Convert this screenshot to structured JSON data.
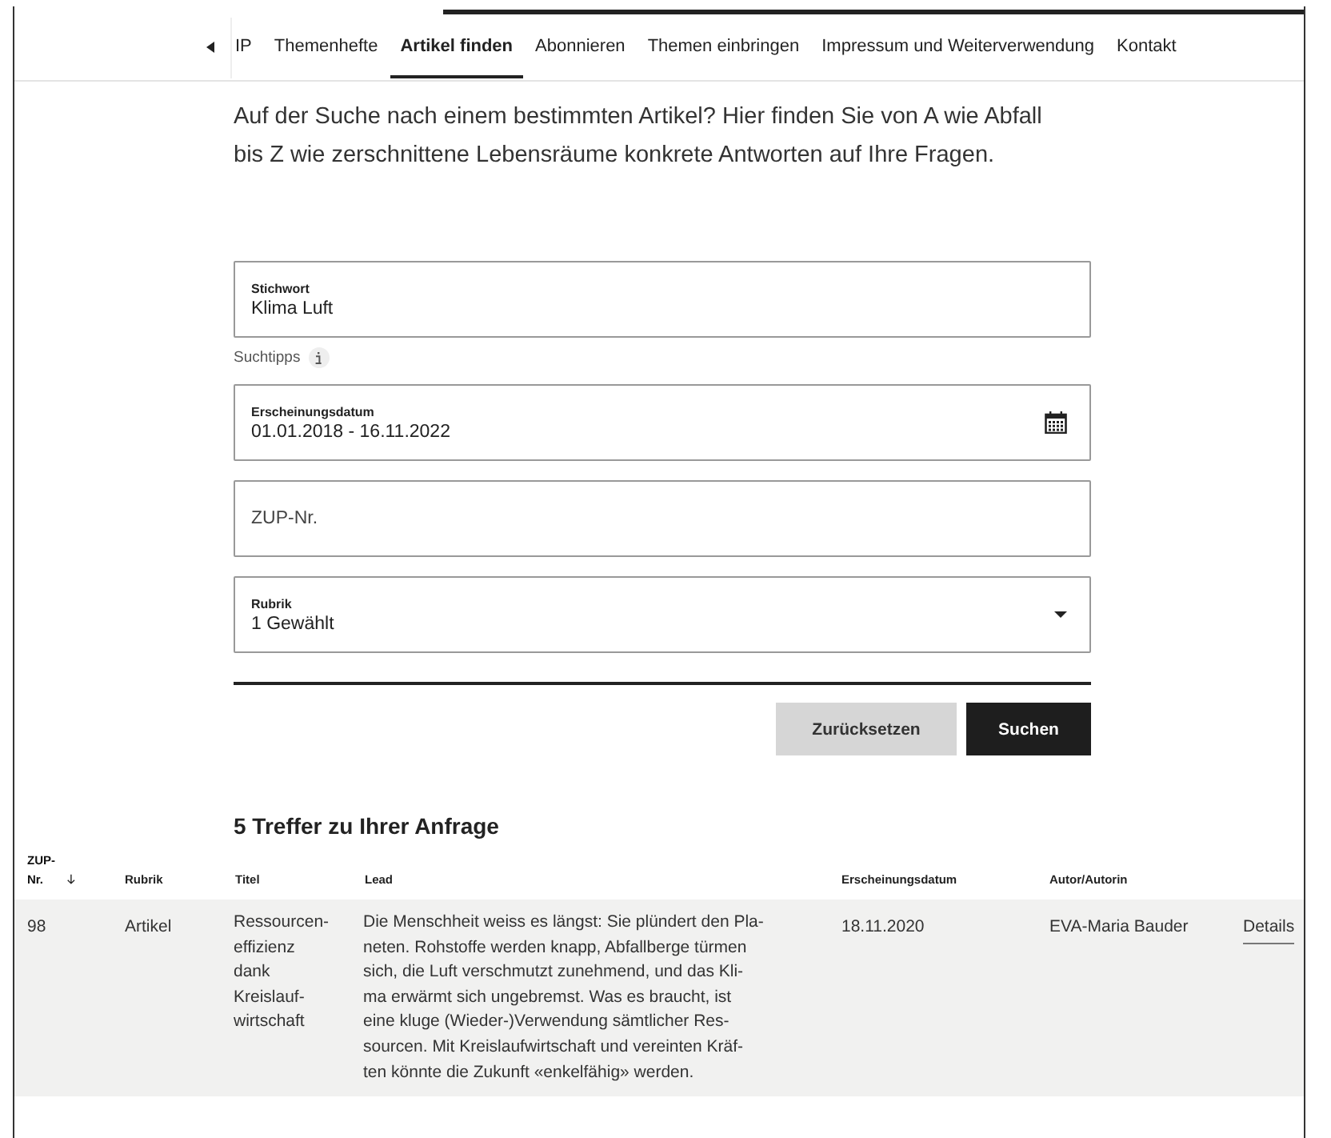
{
  "nav": {
    "tabs": [
      {
        "label": "IP",
        "selected": false
      },
      {
        "label": "Themenhefte",
        "selected": false
      },
      {
        "label": "Artikel finden",
        "selected": true
      },
      {
        "label": "Abonnieren",
        "selected": false
      },
      {
        "label": "Themen einbringen",
        "selected": false
      },
      {
        "label": "Impressum und Weiterverwendung",
        "selected": false
      },
      {
        "label": "Kontakt",
        "selected": false
      }
    ]
  },
  "intro": "Auf der Suche nach einem bestimmten Artikel? Hier finden Sie von A wie Abfall bis Z wie zerschnittene Lebensräume konkrete Antworten auf Ihre Fragen.",
  "form": {
    "fields": [
      {
        "kind": "text",
        "label": "Stichwort",
        "value": "Klima Luft"
      },
      {
        "kind": "hint",
        "label": "Suchtipps"
      },
      {
        "kind": "date",
        "label": "Erscheinungsdatum",
        "value": "01.01.2018 - 16.11.2022"
      },
      {
        "kind": "text",
        "placeholder": "ZUP-Nr."
      },
      {
        "kind": "select",
        "label": "Rubrik",
        "value": "1 Gewählt"
      }
    ],
    "buttons": [
      {
        "label": "Zurücksetzen",
        "kind": "secondary"
      },
      {
        "label": "Suchen",
        "kind": "primary"
      }
    ]
  },
  "results": {
    "heading": "5 Treffer zu Ihrer Anfrage",
    "columns": [
      {
        "label": "ZUP-Nr.",
        "sorted": true
      },
      {
        "label": "Rubrik",
        "sorted": false
      },
      {
        "label": "Titel",
        "sorted": false
      },
      {
        "label": "Lead",
        "sorted": false
      },
      {
        "label": "Erscheinungsdatum",
        "sorted": false
      },
      {
        "label": "Autor/Autorin",
        "sorted": false
      }
    ],
    "rows": [
      {
        "zup": "98",
        "rubrik": "Artikel",
        "title_lines": [
          "Ressourcen-",
          "effizienz",
          "dank",
          "Kreislauf-",
          "wirtschaft"
        ],
        "lead_lines": [
          "Die Menschheit weiss es längst: Sie plündert den Pla-",
          "neten. Rohstoffe werden knapp, Abfallberge türmen",
          "sich, die Luft verschmutzt zunehmend, und das Kli-",
          "ma erwärmt sich ungebremst. Was es braucht, ist",
          "eine kluge (Wieder-)Verwendung sämtlicher Res-",
          "sourcen. Mit Kreislaufwirtschaft und vereinten Kräf-",
          "ten könnte die Zukunft «enkelfähig» werden."
        ],
        "date": "18.11.2020",
        "author": "EVA-Maria Bauder",
        "link": "Details"
      }
    ]
  }
}
